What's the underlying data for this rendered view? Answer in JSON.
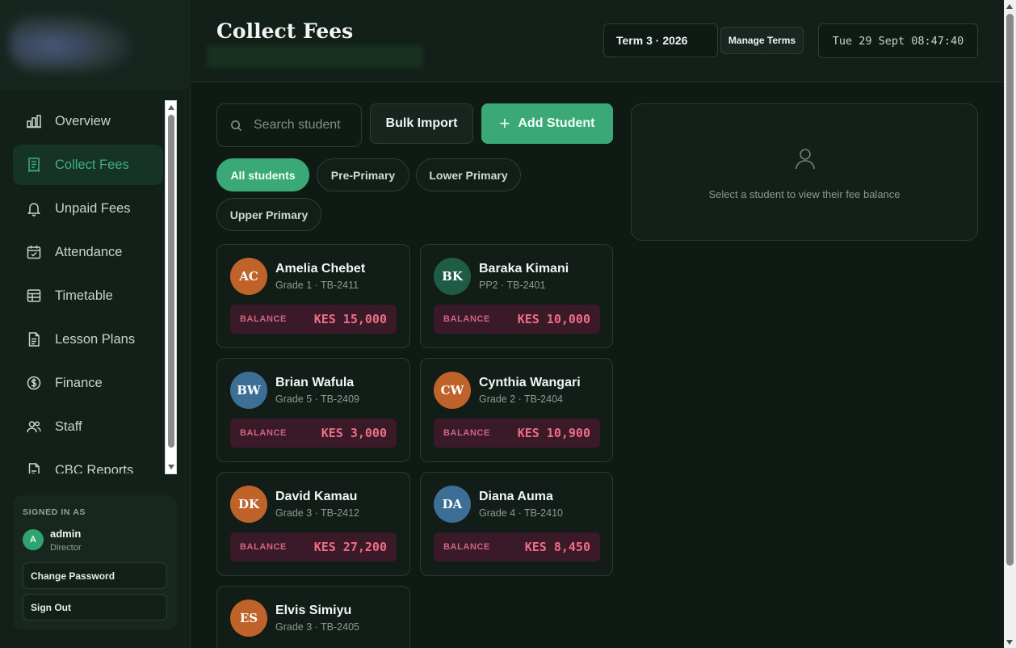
{
  "sidebar": {
    "items": [
      {
        "label": "Overview",
        "icon": "bar-chart-icon"
      },
      {
        "label": "Collect Fees",
        "icon": "receipt-icon",
        "active": true
      },
      {
        "label": "Unpaid Fees",
        "icon": "bell-icon"
      },
      {
        "label": "Attendance",
        "icon": "calendar-check-icon"
      },
      {
        "label": "Timetable",
        "icon": "table-grid-icon"
      },
      {
        "label": "Lesson Plans",
        "icon": "document-icon"
      },
      {
        "label": "Finance",
        "icon": "dollar-circle-icon"
      },
      {
        "label": "Staff",
        "icon": "users-icon"
      },
      {
        "label": "CBC Reports",
        "icon": "report-icon"
      }
    ],
    "user": {
      "signed_in_label": "SIGNED IN AS",
      "initial": "A",
      "name": "admin",
      "role": "Director",
      "change_password": "Change Password",
      "sign_out": "Sign Out"
    }
  },
  "header": {
    "title": "Collect Fees",
    "term": "Term 3 · 2026",
    "manage_terms": "Manage Terms",
    "clock": "Tue 29 Sept 08:47:40"
  },
  "toolbar": {
    "search_placeholder": "Search student",
    "bulk_import": "Bulk Import",
    "add_student": "Add Student"
  },
  "filters": [
    "All students",
    "Pre-Primary",
    "Lower Primary",
    "Upper Primary"
  ],
  "balance_label": "BALANCE",
  "students": [
    {
      "initials": "AC",
      "name": "Amelia Chebet",
      "meta": "Grade 1 · TB-2411",
      "balance": "KES 15,000",
      "color": "#c0632a"
    },
    {
      "initials": "BK",
      "name": "Baraka Kimani",
      "meta": "PP2 · TB-2401",
      "balance": "KES 10,000",
      "color": "#1f5c46"
    },
    {
      "initials": "BW",
      "name": "Brian Wafula",
      "meta": "Grade 5 · TB-2409",
      "balance": "KES 3,000",
      "color": "#3d6e96"
    },
    {
      "initials": "CW",
      "name": "Cynthia Wangari",
      "meta": "Grade 2 · TB-2404",
      "balance": "KES 10,900",
      "color": "#c0632a"
    },
    {
      "initials": "DK",
      "name": "David Kamau",
      "meta": "Grade 3 · TB-2412",
      "balance": "KES 27,200",
      "color": "#c0632a"
    },
    {
      "initials": "DA",
      "name": "Diana Auma",
      "meta": "Grade 4 · TB-2410",
      "balance": "KES 8,450",
      "color": "#3d6e96"
    },
    {
      "initials": "ES",
      "name": "Elvis Simiyu",
      "meta": "Grade 3 · TB-2405",
      "balance": "",
      "color": "#c0632a"
    }
  ],
  "detail": {
    "message": "Select a student to view their fee balance"
  },
  "colors": {
    "accent": "#3aa977",
    "balance_bg": "#3a1a28",
    "balance_text": "#f06d86"
  }
}
